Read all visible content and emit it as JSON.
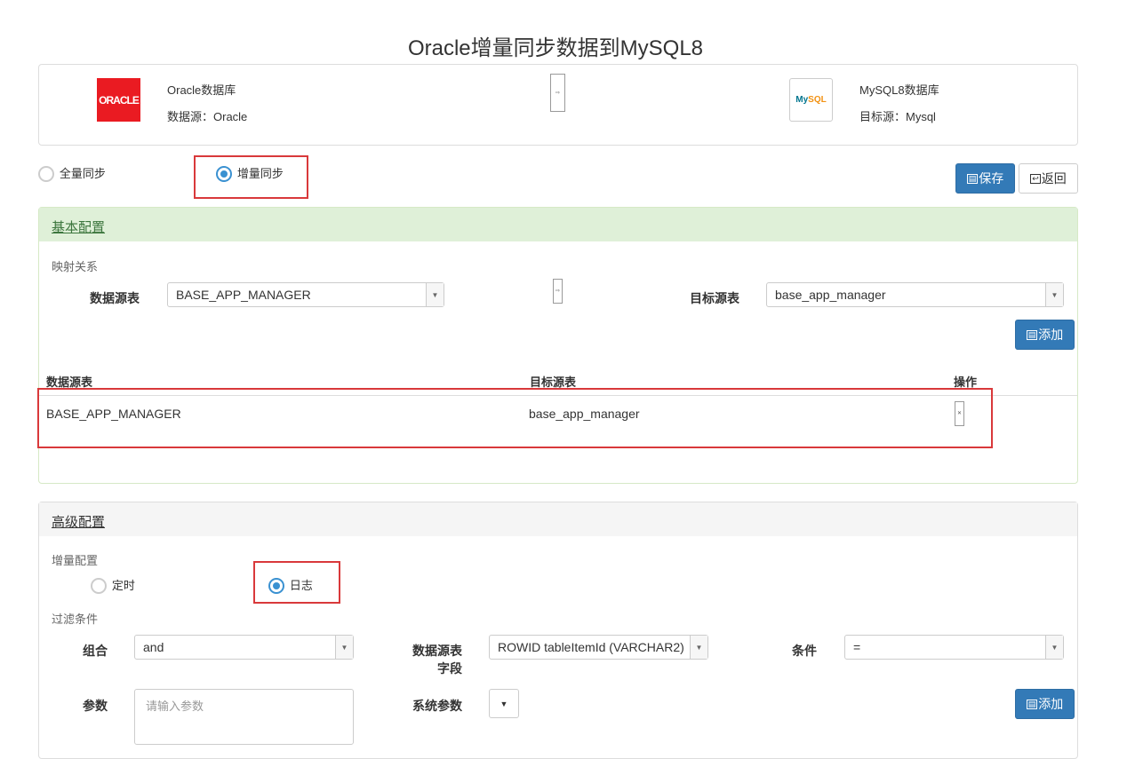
{
  "page": {
    "title": "Oracle增量同步数据到MySQL8"
  },
  "source_db": {
    "logo_text": "ORACLE",
    "name": "Oracle数据库",
    "source_label": "数据源：Oracle"
  },
  "target_db": {
    "logo_text_a": "My",
    "logo_text_b": "SQL",
    "name": "MySQL8数据库",
    "target_label": "目标源：Mysql"
  },
  "sync_mode": {
    "full_label": "全量同步",
    "incremental_label": "增量同步",
    "selected": "incremental"
  },
  "toolbar": {
    "save_label": "保存",
    "back_label": "返回"
  },
  "basic_config": {
    "heading": "基本配置",
    "mapping_label": "映射关系",
    "source_table_label": "数据源表",
    "source_table_value": "BASE_APP_MANAGER",
    "target_table_label": "目标源表",
    "target_table_value": "base_app_manager",
    "add_label": "添加",
    "table": {
      "headers": [
        "数据源表",
        "目标源表",
        "操作"
      ],
      "rows": [
        {
          "source": "BASE_APP_MANAGER",
          "target": "base_app_manager"
        }
      ]
    }
  },
  "advanced_config": {
    "heading": "高级配置",
    "incremental_label": "增量配置",
    "timer_label": "定时",
    "log_label": "日志",
    "selected": "log",
    "filter_label": "过滤条件",
    "combine_label": "组合",
    "combine_value": "and",
    "field_label_line1": "数据源表",
    "field_label_line2": "字段",
    "field_value": "ROWID tableItemId (VARCHAR2)",
    "condition_label": "条件",
    "condition_value": "=",
    "param_label": "参数",
    "param_placeholder": "请输入参数",
    "sys_param_label": "系统参数",
    "add_label": "添加"
  },
  "colors": {
    "primary": "#337ab7",
    "highlight": "#d9393b",
    "green_heading": "#dff0d8",
    "oracle_red": "#ea1b22"
  }
}
